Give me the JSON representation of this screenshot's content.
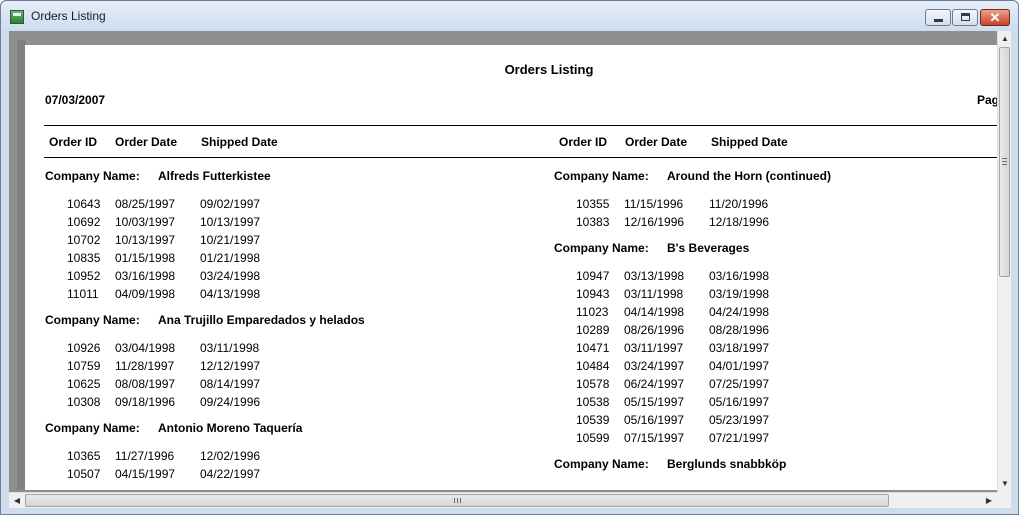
{
  "window": {
    "title": "Orders Listing",
    "close_label": "✕"
  },
  "report": {
    "title": "Orders Listing",
    "date": "07/03/2007",
    "page_label": "Page",
    "headers": {
      "order_id": "Order ID",
      "order_date": "Order Date",
      "shipped_date": "Shipped Date"
    },
    "company_label": "Company Name:",
    "left_groups": [
      {
        "name": "Alfreds Futterkistee",
        "rows": [
          [
            "10643",
            "08/25/1997",
            "09/02/1997"
          ],
          [
            "10692",
            "10/03/1997",
            "10/13/1997"
          ],
          [
            "10702",
            "10/13/1997",
            "10/21/1997"
          ],
          [
            "10835",
            "01/15/1998",
            "01/21/1998"
          ],
          [
            "10952",
            "03/16/1998",
            "03/24/1998"
          ],
          [
            "11011",
            "04/09/1998",
            "04/13/1998"
          ]
        ]
      },
      {
        "name": "Ana Trujillo Emparedados y helados",
        "rows": [
          [
            "10926",
            "03/04/1998",
            "03/11/1998"
          ],
          [
            "10759",
            "11/28/1997",
            "12/12/1997"
          ],
          [
            "10625",
            "08/08/1997",
            "08/14/1997"
          ],
          [
            "10308",
            "09/18/1996",
            "09/24/1996"
          ]
        ]
      },
      {
        "name": "Antonio Moreno Taquería",
        "rows": [
          [
            "10365",
            "11/27/1996",
            "12/02/1996"
          ],
          [
            "10507",
            "04/15/1997",
            "04/22/1997"
          ]
        ]
      }
    ],
    "right_groups": [
      {
        "name": "Around the Horn (continued)",
        "rows": [
          [
            "10355",
            "11/15/1996",
            "11/20/1996"
          ],
          [
            "10383",
            "12/16/1996",
            "12/18/1996"
          ]
        ]
      },
      {
        "name": "B's Beverages",
        "rows": [
          [
            "10947",
            "03/13/1998",
            "03/16/1998"
          ],
          [
            "10943",
            "03/11/1998",
            "03/19/1998"
          ],
          [
            "11023",
            "04/14/1998",
            "04/24/1998"
          ],
          [
            "10289",
            "08/26/1996",
            "08/28/1996"
          ],
          [
            "10471",
            "03/11/1997",
            "03/18/1997"
          ],
          [
            "10484",
            "03/24/1997",
            "04/01/1997"
          ],
          [
            "10578",
            "06/24/1997",
            "07/25/1997"
          ],
          [
            "10538",
            "05/15/1997",
            "05/16/1997"
          ],
          [
            "10539",
            "05/16/1997",
            "05/23/1997"
          ],
          [
            "10599",
            "07/15/1997",
            "07/21/1997"
          ]
        ]
      },
      {
        "name": "Berglunds snabbköp",
        "rows": []
      }
    ]
  }
}
